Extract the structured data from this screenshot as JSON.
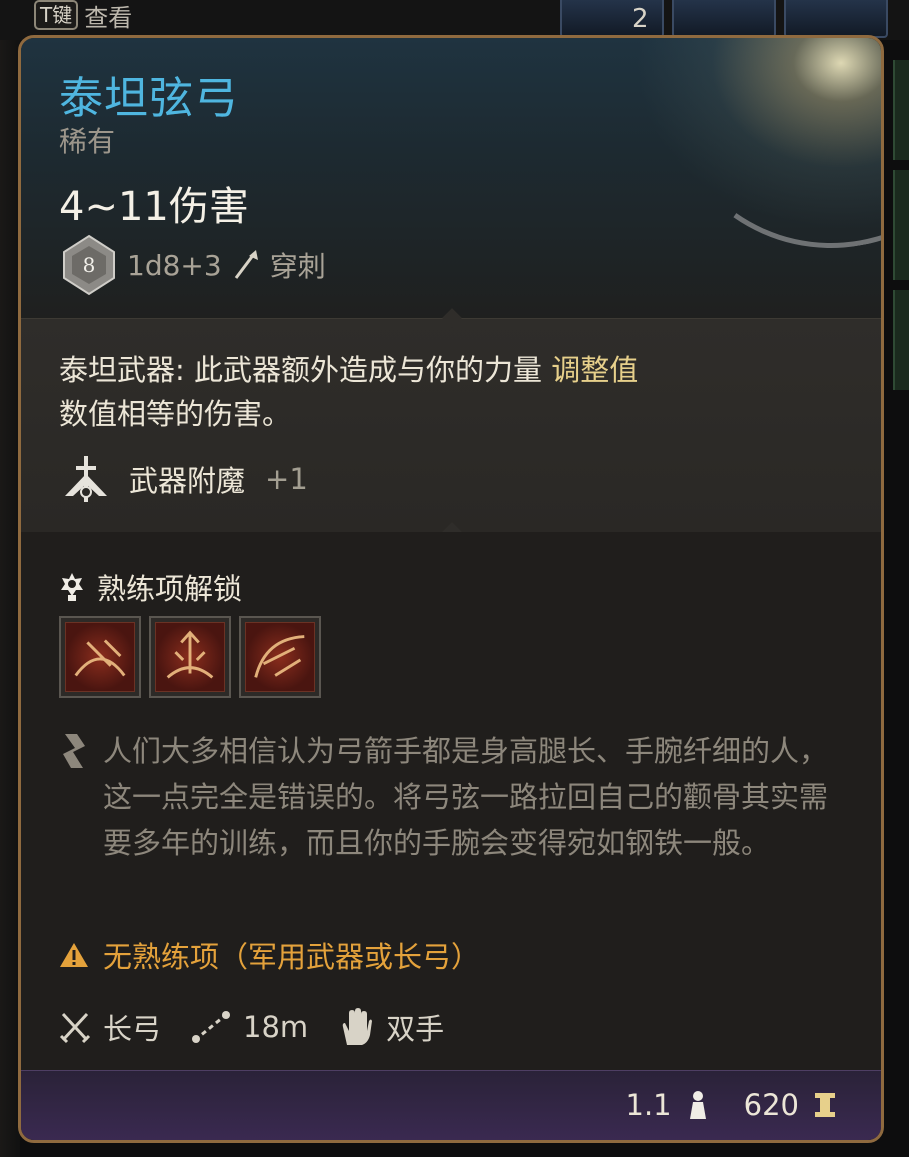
{
  "background": {
    "key_hint": {
      "key": "T键",
      "label": "查看"
    },
    "slot_count": "2"
  },
  "tooltip": {
    "item_name": "泰坦弦弓",
    "rarity": "稀有",
    "damage_range": "4~11伤害",
    "damage_dice_face": "8",
    "damage_formula": "1d8+3",
    "damage_type": "穿刺",
    "titan_label": "泰坦武器:",
    "titan_text_a": " 此武器额外造成与你的力量 ",
    "titan_highlight": "调整值",
    "titan_text_b": "数值相等的伤害。",
    "enchant_label": "武器附魔",
    "enchant_value": "+1",
    "proficiency_header": "熟练项解锁",
    "proficiency_icons": [
      "proficiency-action-1-icon",
      "proficiency-action-2-icon",
      "proficiency-action-3-icon"
    ],
    "flavor_text": "人们大多相信认为弓箭手都是身高腿长、手腕纤细的人，这一点完全是错误的。将弓弦一路拉回自己的颧骨其实需要多年的训练，而且你的手腕会变得宛如钢铁一般。",
    "warning": "无熟练项（军用武器或长弓）",
    "properties": {
      "weapon_type": "长弓",
      "range": "18m",
      "handedness": "双手"
    },
    "footer": {
      "weight": "1.1",
      "value": "620"
    }
  },
  "colors": {
    "title": "#4fb6e0",
    "highlight": "#e7d08b",
    "warning": "#e4a23b",
    "border": "#8f6a3f",
    "footer_bg": "#3b2a52"
  }
}
